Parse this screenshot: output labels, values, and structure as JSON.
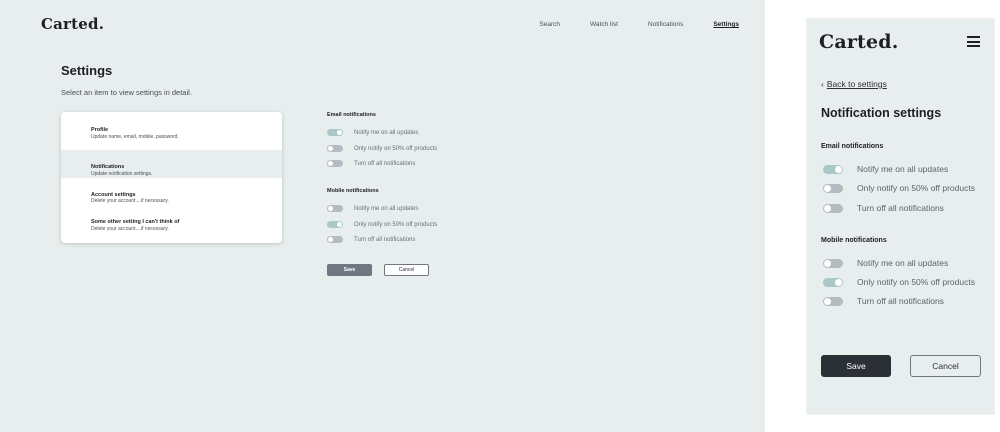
{
  "desktop": {
    "logo": "Carted.",
    "nav": [
      {
        "label": "Search",
        "active": false
      },
      {
        "label": "Watch list",
        "active": false
      },
      {
        "label": "Notifications",
        "active": false
      },
      {
        "label": "Settings",
        "active": true
      }
    ],
    "title": "Settings",
    "subtitle": "Select an item to view settings in detail.",
    "settings_items": [
      {
        "title": "Profile",
        "desc": "Update name, email, mobile, password.",
        "selected": false
      },
      {
        "title": "Notifications",
        "desc": "Update notification settings.",
        "selected": true
      },
      {
        "title": "Account settings",
        "desc": "Delete your account....if necessary.",
        "selected": false
      },
      {
        "title": "Some other setting I can't think of",
        "desc": "Delete your account....if necessary.",
        "selected": false
      }
    ],
    "email_group": {
      "title": "Email notifications",
      "options": [
        {
          "label": "Notify me on all updates",
          "on": true
        },
        {
          "label": "Only notify on 50% off products",
          "on": false
        },
        {
          "label": "Turn off all notifications",
          "on": false
        }
      ]
    },
    "mobile_group": {
      "title": "Mobile notifications",
      "options": [
        {
          "label": "Notify me on all updates",
          "on": false
        },
        {
          "label": "Only notify on 50% off products",
          "on": true
        },
        {
          "label": "Turn off all notifications",
          "on": false
        }
      ]
    },
    "save_label": "Save",
    "cancel_label": "Cancel"
  },
  "mobile": {
    "logo": "Carted.",
    "back_label": "Back to settings",
    "title": "Notification settings",
    "email_group": {
      "title": "Email notifications",
      "options": [
        {
          "label": "Notify me on all updates",
          "on": true
        },
        {
          "label": "Only notify on 50% off products",
          "on": false
        },
        {
          "label": "Turn off all notifications",
          "on": false
        }
      ]
    },
    "mobile_group": {
      "title": "Mobile notifications",
      "options": [
        {
          "label": "Notify me on all updates",
          "on": false
        },
        {
          "label": "Only notify on 50% off products",
          "on": true
        },
        {
          "label": "Turn off all notifications",
          "on": false
        }
      ]
    },
    "save_label": "Save",
    "cancel_label": "Cancel"
  },
  "colors": {
    "background": "#e8eeee",
    "toggle_on": "#a9c8c8",
    "toggle_off": "#b5bcc1",
    "primary_button": "#6f7780",
    "mobile_primary_button": "#2b3036"
  }
}
